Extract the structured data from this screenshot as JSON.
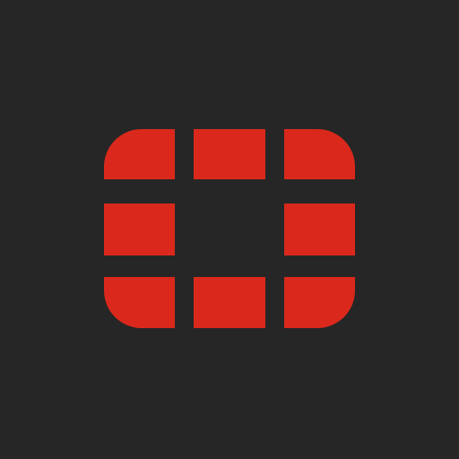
{
  "app": {
    "icon": "fortinet-logo-icon"
  },
  "colors": {
    "background": "#262626",
    "logo": "#DA291C"
  }
}
